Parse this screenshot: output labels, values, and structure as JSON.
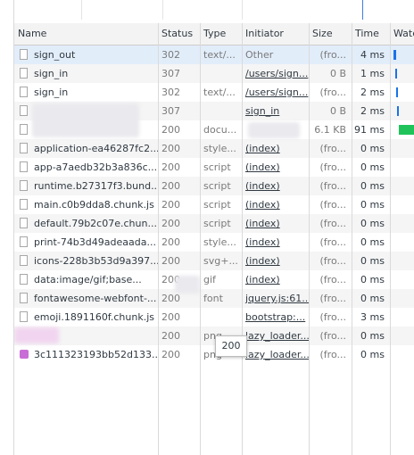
{
  "columns": {
    "name": "Name",
    "status": "Status",
    "type": "Type",
    "initiator": "Initiator",
    "size": "Size",
    "time": "Time",
    "waterfall": "Wate"
  },
  "rows": [
    {
      "name": "sign_out",
      "status": "302",
      "type": "text/...",
      "initiator": "Other",
      "size": "(fro...",
      "time": "4 ms",
      "icon": "file-icon"
    },
    {
      "name": "sign_in",
      "status": "307",
      "type": "",
      "initiator": "/users/sign...",
      "size": "0 B",
      "time": "1 ms",
      "icon": "file-icon"
    },
    {
      "name": "sign_in",
      "status": "302",
      "type": "text/...",
      "initiator": "/users/sign...",
      "size": "(fro...",
      "time": "2 ms",
      "icon": "file-icon"
    },
    {
      "name": "",
      "status": "307",
      "type": "",
      "initiator": "sign_in",
      "size": "0 B",
      "time": "2 ms",
      "icon": "file-icon"
    },
    {
      "name": "",
      "status": "200",
      "type": "docu...",
      "initiator": "",
      "size": "6.1 KB",
      "time": "91 ms",
      "icon": "file-icon"
    },
    {
      "name": "application-ea46287fc2...",
      "status": "200",
      "type": "style...",
      "initiator": "(index)",
      "size": "(fro...",
      "time": "0 ms",
      "icon": "file-icon"
    },
    {
      "name": "app-a7aedb32b3a836c...",
      "status": "200",
      "type": "script",
      "initiator": "(index)",
      "size": "(fro...",
      "time": "0 ms",
      "icon": "file-icon"
    },
    {
      "name": "runtime.b27317f3.bund...",
      "status": "200",
      "type": "script",
      "initiator": "(index)",
      "size": "(fro...",
      "time": "0 ms",
      "icon": "file-icon"
    },
    {
      "name": "main.c0b9dda8.chunk.js",
      "status": "200",
      "type": "script",
      "initiator": "(index)",
      "size": "(fro...",
      "time": "0 ms",
      "icon": "file-icon"
    },
    {
      "name": "default.79b2c07e.chun...",
      "status": "200",
      "type": "script",
      "initiator": "(index)",
      "size": "(fro...",
      "time": "0 ms",
      "icon": "file-icon"
    },
    {
      "name": "print-74b3d49adeaada...",
      "status": "200",
      "type": "style...",
      "initiator": "(index)",
      "size": "(fro...",
      "time": "0 ms",
      "icon": "file-icon"
    },
    {
      "name": "icons-228b3b53d9a397...",
      "status": "200",
      "type": "svg+...",
      "initiator": "(index)",
      "size": "(fro...",
      "time": "0 ms",
      "icon": "file-icon"
    },
    {
      "name": "data:image/gif;base...",
      "status": "200",
      "type": "gif",
      "initiator": "(index)",
      "size": "(fro...",
      "time": "0 ms",
      "icon": "file-icon"
    },
    {
      "name": "fontawesome-webfont-...",
      "status": "200",
      "type": "font",
      "initiator": "jquery.js:61...",
      "size": "(fro...",
      "time": "0 ms",
      "icon": "file-icon"
    },
    {
      "name": "emoji.1891160f.chunk.js",
      "status": "200",
      "type": "",
      "initiator": "bootstrap:...",
      "size": "(fro...",
      "time": "3 ms",
      "icon": "file-icon"
    },
    {
      "name": "",
      "status": "200",
      "type": "png",
      "initiator": "lazy_loader...",
      "size": "(fro...",
      "time": "0 ms",
      "icon": "image-icon"
    },
    {
      "name": "3c111323193bb52d133...",
      "status": "200",
      "type": "png",
      "initiator": "lazy_loader...",
      "size": "(fro...",
      "time": "0 ms",
      "icon": "image-icon"
    }
  ],
  "tooltip": "200",
  "colors": {
    "header_bg": "#f3f3f3",
    "selected_row": "#e2edfa",
    "waterfall_blue": "#1a73e8",
    "waterfall_green": "#1fc35a"
  }
}
